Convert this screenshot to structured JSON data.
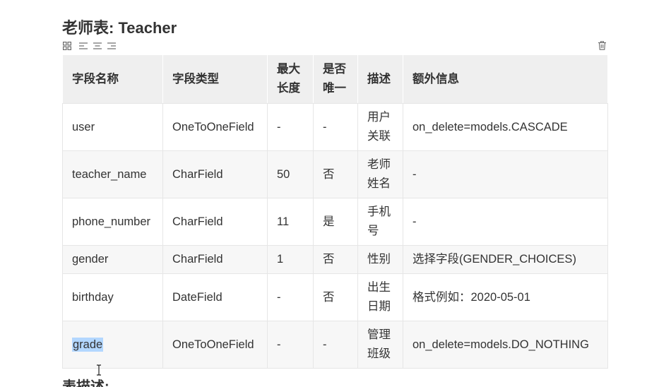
{
  "document": {
    "title": "老师表: Teacher",
    "next_heading": "表描述:"
  },
  "table_toolbar": {
    "left_icons": [
      "table-grid-icon",
      "align-left-icon",
      "align-center-icon",
      "align-right-icon"
    ],
    "right_icon": "trash-icon"
  },
  "table": {
    "headers": [
      "字段名称",
      "字段类型",
      "最大长度",
      "是否唯一",
      "描述",
      "额外信息"
    ],
    "rows": [
      [
        "user",
        "OneToOneField",
        "-",
        "-",
        "用户关联",
        "on_delete=models.CASCADE"
      ],
      [
        "teacher_name",
        "CharField",
        "50",
        "否",
        "老师姓名",
        "-"
      ],
      [
        "phone_number",
        "CharField",
        "11",
        "是",
        "手机号",
        "-"
      ],
      [
        "gender",
        "CharField",
        "1",
        "否",
        "性别",
        "选择字段(GENDER_CHOICES)"
      ],
      [
        "birthday",
        "DateField",
        "-",
        "否",
        "出生日期",
        "格式例如：2020-05-01"
      ],
      [
        "grade",
        "OneToOneField",
        "-",
        "-",
        "管理班级",
        "on_delete=models.DO_NOTHING"
      ]
    ]
  },
  "colors": {
    "text": "#333333",
    "header_bg": "#efefef",
    "stripe_bg": "#f7f7f7",
    "border": "#e6e6e6",
    "selection": "#b3d7ff",
    "icon": "#6b6b6b"
  }
}
